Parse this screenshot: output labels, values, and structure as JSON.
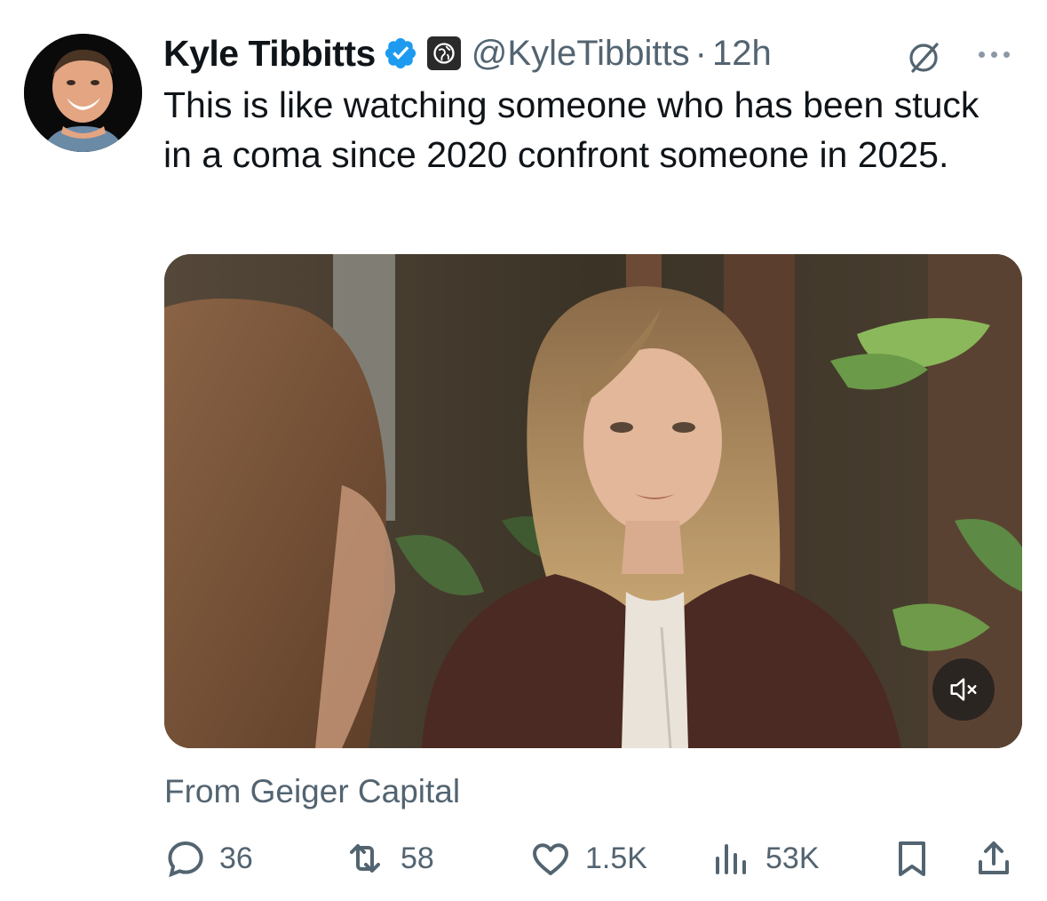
{
  "author": {
    "name": "Kyle Tibbitts",
    "handle": "@KyleTibbitts",
    "separator": "·",
    "time": "12h",
    "verified_color": "#1d9bf0"
  },
  "tweet": {
    "text": "This is like watching someone who has been stuck in a coma since 2020 confront someone in 2025."
  },
  "media": {
    "source": "From Geiger Capital"
  },
  "actions": {
    "replies": "36",
    "reposts": "58",
    "likes": "1.5K",
    "views": "53K"
  },
  "icons": [
    "verified-badge-icon",
    "affiliate-badge-icon",
    "grok-icon",
    "more-icon",
    "mute-icon",
    "reply-icon",
    "repost-icon",
    "like-icon",
    "views-icon",
    "bookmark-icon",
    "share-icon"
  ],
  "colors": {
    "secondary_text": "#536471",
    "primary_text": "#0f1419",
    "accent": "#1d9bf0"
  }
}
